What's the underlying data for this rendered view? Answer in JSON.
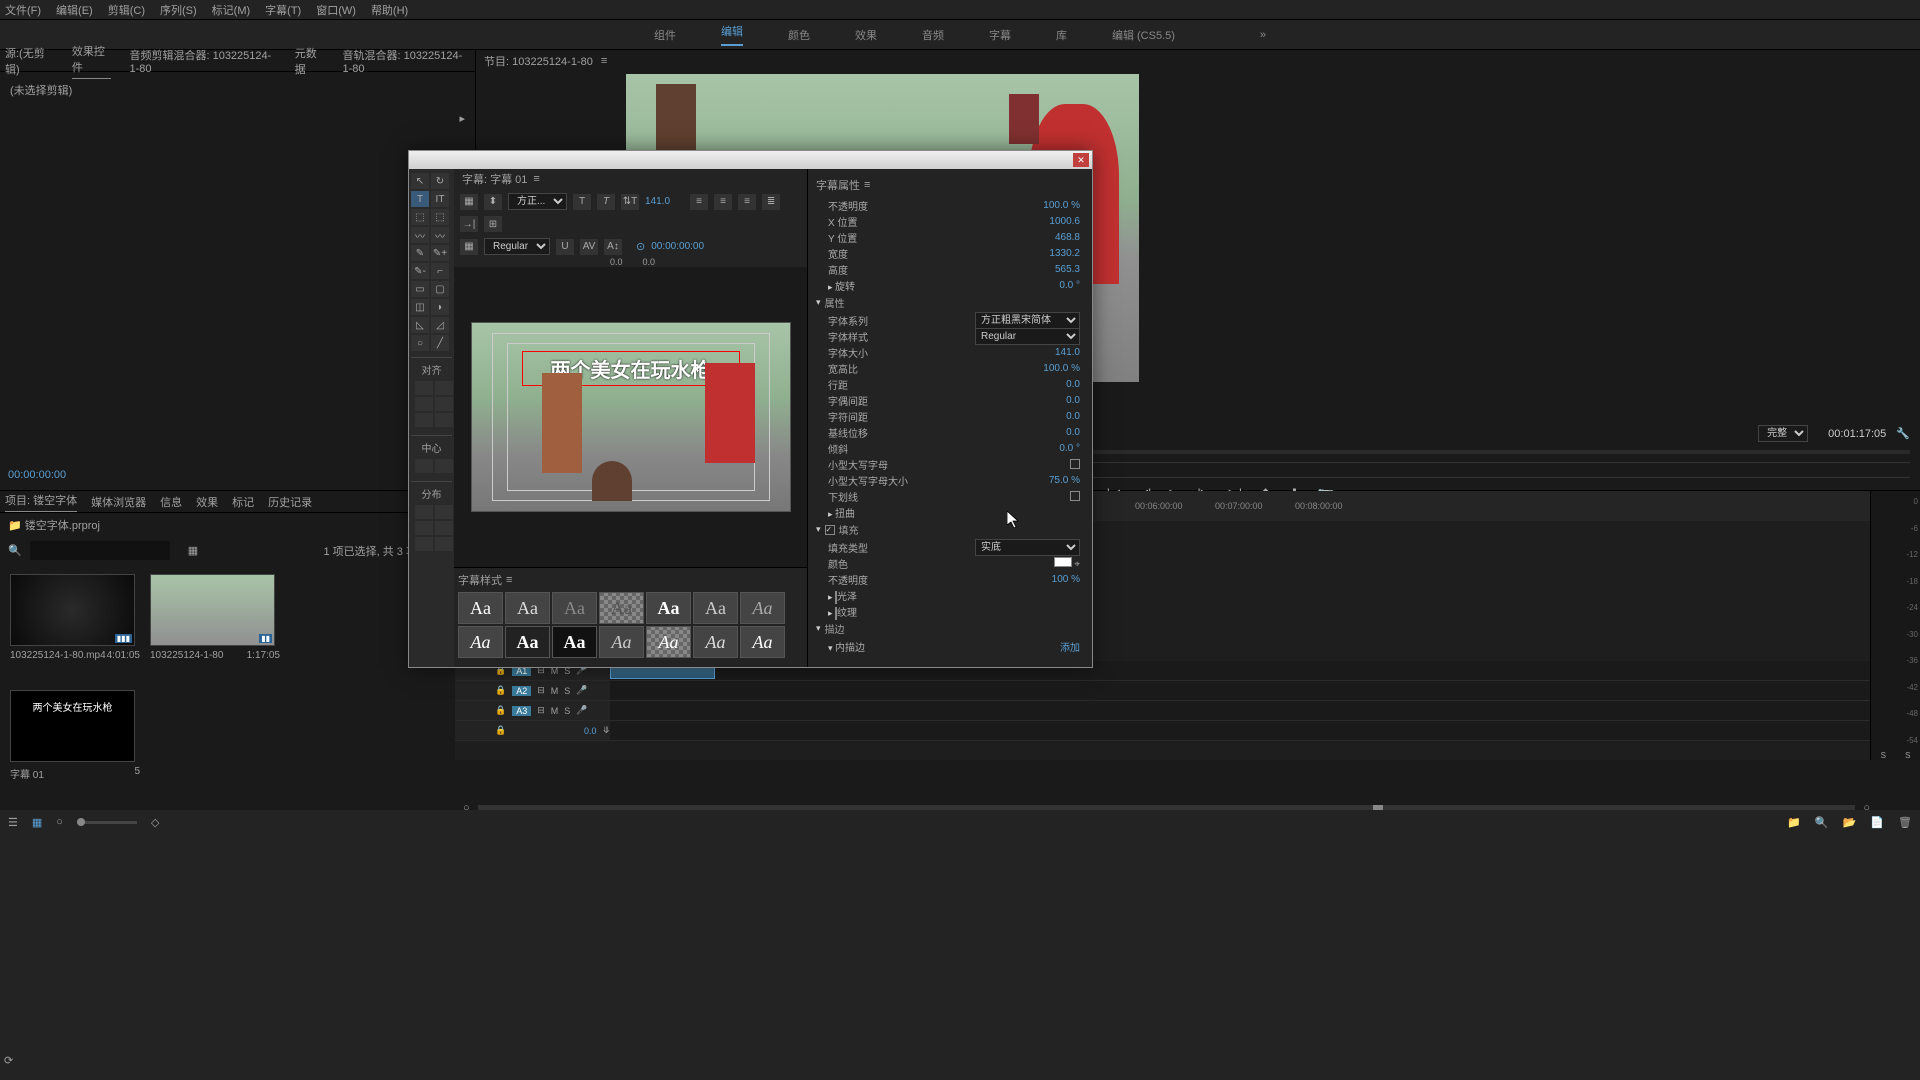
{
  "menu": {
    "file": "文件(F)",
    "edit": "编辑(E)",
    "clip": "剪辑(C)",
    "sequence": "序列(S)",
    "marker": "标记(M)",
    "subtitle": "字幕(T)",
    "window": "窗口(W)",
    "help": "帮助(H)"
  },
  "workspace": {
    "assembly": "组件",
    "editing": "编辑",
    "color": "颜色",
    "effects": "效果",
    "audio": "音频",
    "titles": "字幕",
    "library": "库",
    "legacy": "编辑 (CS5.5)",
    "more": "»"
  },
  "source": {
    "tab1": "源:(无剪辑)",
    "tab2": "效果控件",
    "tab3": "音频剪辑混合器: 103225124-1-80",
    "tab4": "元数据",
    "tab5": "音轨混合器: 103225124-1-80",
    "notice": "(未选择剪辑)",
    "tc": "00:00:00:00"
  },
  "program": {
    "tab": "节目: 103225124-1-80",
    "fit": "完整",
    "tc": "00:01:17:05"
  },
  "ruler": {
    "t0": "00:06:00:00",
    "t1": "00:07:00:00",
    "t2": "00:08:00:00"
  },
  "project": {
    "tab1": "项目: 镂空字体",
    "tab2": "媒体浏览器",
    "tab3": "信息",
    "tab4": "效果",
    "tab5": "标记",
    "tab6": "历史记录",
    "filename": "镂空字体.prproj",
    "selection": "1 项已选择, 共 3 项",
    "item1": {
      "name": "103225124-1-80.mp4",
      "dur": "4:01:05"
    },
    "item2": {
      "name": "103225124-1-80",
      "dur": "1:17:05"
    },
    "item3": {
      "name": "字幕 01",
      "dur": "5"
    },
    "titletext": "两个美女在玩水枪"
  },
  "timeline": {
    "cursor_tc": "0.0",
    "tracks": {
      "a1": "A1",
      "a2": "A2",
      "a3": "A3"
    },
    "hdr": {
      "lock": "🔒",
      "m": "M",
      "s": "S",
      "mic": "🎤",
      "eye": "👁"
    }
  },
  "titler": {
    "tab": "字幕: 字幕 01",
    "font": "方正...",
    "style": "Regular",
    "size": "141.0",
    "tc": "00:00:00:00",
    "k1": "0.0",
    "k2": "0.0",
    "styles_header": "字幕样式",
    "props_header": "字幕属性",
    "props": {
      "opacity": {
        "l": "不透明度",
        "v": "100.0 %"
      },
      "xpos": {
        "l": "X 位置",
        "v": "1000.6"
      },
      "ypos": {
        "l": "Y 位置",
        "v": "468.8"
      },
      "width": {
        "l": "宽度",
        "v": "1330.2"
      },
      "height": {
        "l": "高度",
        "v": "565.3"
      },
      "rotation": {
        "l": "旋转",
        "v": "0.0 °"
      },
      "attributes": {
        "l": "属性"
      },
      "fontfam": {
        "l": "字体系列",
        "v": "方正粗黑宋简体"
      },
      "fontstyle": {
        "l": "字体样式",
        "v": "Regular"
      },
      "fontsize": {
        "l": "字体大小",
        "v": "141.0"
      },
      "aspect": {
        "l": "宽高比",
        "v": "100.0 %"
      },
      "leading": {
        "l": "行距",
        "v": "0.0"
      },
      "kerning": {
        "l": "字偶间距",
        "v": "0.0"
      },
      "tracking": {
        "l": "字符间距",
        "v": "0.0"
      },
      "baseline": {
        "l": "基线位移",
        "v": "0.0"
      },
      "slant": {
        "l": "倾斜",
        "v": "0.0 °"
      },
      "smallcaps": {
        "l": "小型大写字母"
      },
      "smallcapssize": {
        "l": "小型大写字母大小",
        "v": "75.0 %"
      },
      "underline": {
        "l": "下划线"
      },
      "distort": {
        "l": "扭曲"
      },
      "fill": {
        "l": "填充"
      },
      "filltype": {
        "l": "填充类型",
        "v": "实底"
      },
      "fillcolor": {
        "l": "颜色"
      },
      "fillopacity": {
        "l": "不透明度",
        "v": "100 %"
      },
      "sheen": {
        "l": "光泽"
      },
      "texture": {
        "l": "纹理"
      },
      "stroke": {
        "l": "描边"
      },
      "innerstroke": {
        "l": "内描边",
        "v": "添加"
      }
    },
    "align": "对齐",
    "center": "中心",
    "distribute": "分布",
    "swatches": [
      "Aa",
      "Aa",
      "Aa",
      "Aa",
      "Aa",
      "Aa",
      "Aa",
      "Aa",
      "Aa",
      "Aa",
      "Aa",
      "Aa",
      "Aa",
      "Aa"
    ],
    "text": "两个美女在玩水枪"
  },
  "meter": {
    "labels": [
      "0",
      "-6",
      "-12",
      "-18",
      "-24",
      "-30",
      "-36",
      "-42",
      "-48",
      "-54"
    ]
  }
}
